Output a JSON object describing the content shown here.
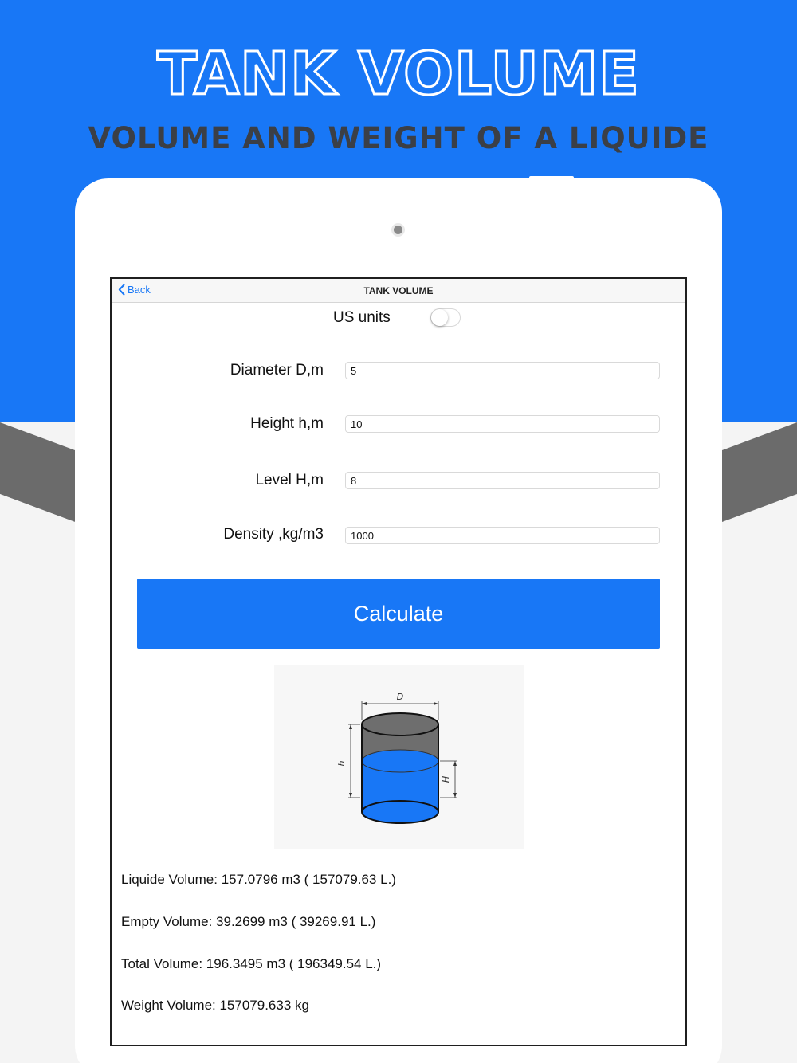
{
  "hero": {
    "title": "TANK VOLUME",
    "subtitle": "VOLUME AND WEIGHT OF A LIQUIDE"
  },
  "colors": {
    "brand_blue": "#1877f6",
    "band_gray": "#6b6b6b",
    "liquid_blue": "#1877f6"
  },
  "navbar": {
    "back_label": "Back",
    "title": "TANK VOLUME"
  },
  "settings": {
    "us_units_label": "US units",
    "us_units_on": false
  },
  "fields": {
    "diameter": {
      "label": "Diameter D,m",
      "value": "5"
    },
    "height": {
      "label": "Height h,m",
      "value": "10"
    },
    "level": {
      "label": "Level H,m",
      "value": "8"
    },
    "density": {
      "label": "Density ,kg/m3",
      "value": "1000"
    }
  },
  "calculate_label": "Calculate",
  "diagram_labels": {
    "diameter": "D",
    "height": "h",
    "level": "H"
  },
  "results": {
    "liquid": "Liquide Volume: 157.0796 m3 ( 157079.63 L.)",
    "empty": "Empty Volume: 39.2699 m3 ( 39269.91 L.)",
    "total": "Total Volume: 196.3495 m3 ( 196349.54 L.)",
    "weight": "Weight Volume: 157079.633 kg"
  }
}
